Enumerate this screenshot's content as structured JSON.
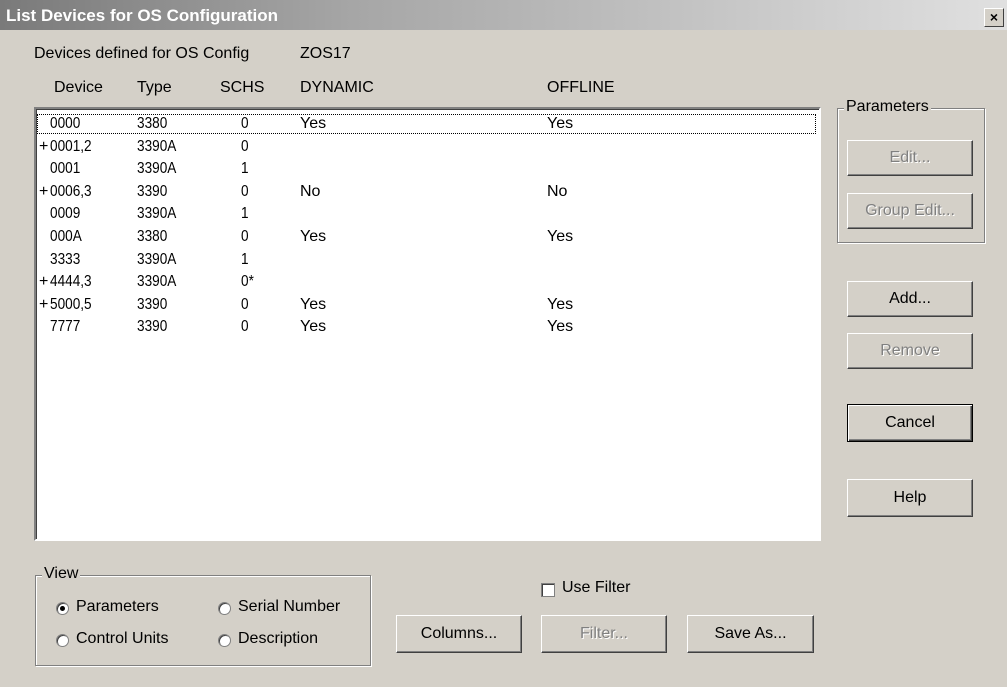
{
  "window": {
    "title": "List Devices for OS Configuration",
    "close_glyph": "×"
  },
  "header": {
    "label": "Devices defined for OS Config",
    "config_name": "ZOS17"
  },
  "columns": [
    "Device",
    "Type",
    "SCHS",
    "DYNAMIC",
    "OFFLINE"
  ],
  "rows": [
    {
      "expand": "",
      "device": "0000",
      "type": "3380",
      "schs": "0",
      "dynamic": "Yes",
      "offline": "Yes",
      "selected": true
    },
    {
      "expand": "+",
      "device": "0001,2",
      "type": "3390A",
      "schs": "0",
      "dynamic": "",
      "offline": ""
    },
    {
      "expand": "",
      "device": "0001",
      "type": "3390A",
      "schs": "1",
      "dynamic": "",
      "offline": ""
    },
    {
      "expand": "+",
      "device": "0006,3",
      "type": "3390",
      "schs": "0",
      "dynamic": "No",
      "offline": "No"
    },
    {
      "expand": "",
      "device": "0009",
      "type": "3390A",
      "schs": "1",
      "dynamic": "",
      "offline": ""
    },
    {
      "expand": "",
      "device": "000A",
      "type": "3380",
      "schs": "0",
      "dynamic": "Yes",
      "offline": "Yes"
    },
    {
      "expand": "",
      "device": "3333",
      "type": "3390A",
      "schs": "1",
      "dynamic": "",
      "offline": ""
    },
    {
      "expand": "+",
      "device": "4444,3",
      "type": "3390A",
      "schs": "0*",
      "dynamic": "",
      "offline": ""
    },
    {
      "expand": "+",
      "device": "5000,5",
      "type": "3390",
      "schs": "0",
      "dynamic": "Yes",
      "offline": "Yes"
    },
    {
      "expand": "",
      "device": "7777",
      "type": "3390",
      "schs": "0",
      "dynamic": "Yes",
      "offline": "Yes"
    }
  ],
  "parameters_group": {
    "label": "Parameters",
    "edit": "Edit...",
    "group_edit": "Group Edit..."
  },
  "buttons": {
    "add": "Add...",
    "remove": "Remove",
    "cancel": "Cancel",
    "help": "Help",
    "columns": "Columns...",
    "filter": "Filter...",
    "save_as": "Save As..."
  },
  "view_group": {
    "label": "View",
    "options": [
      "Parameters",
      "Serial Number",
      "Control Units",
      "Description"
    ],
    "selected": "Parameters"
  },
  "use_filter": {
    "label": "Use Filter",
    "checked": false
  }
}
